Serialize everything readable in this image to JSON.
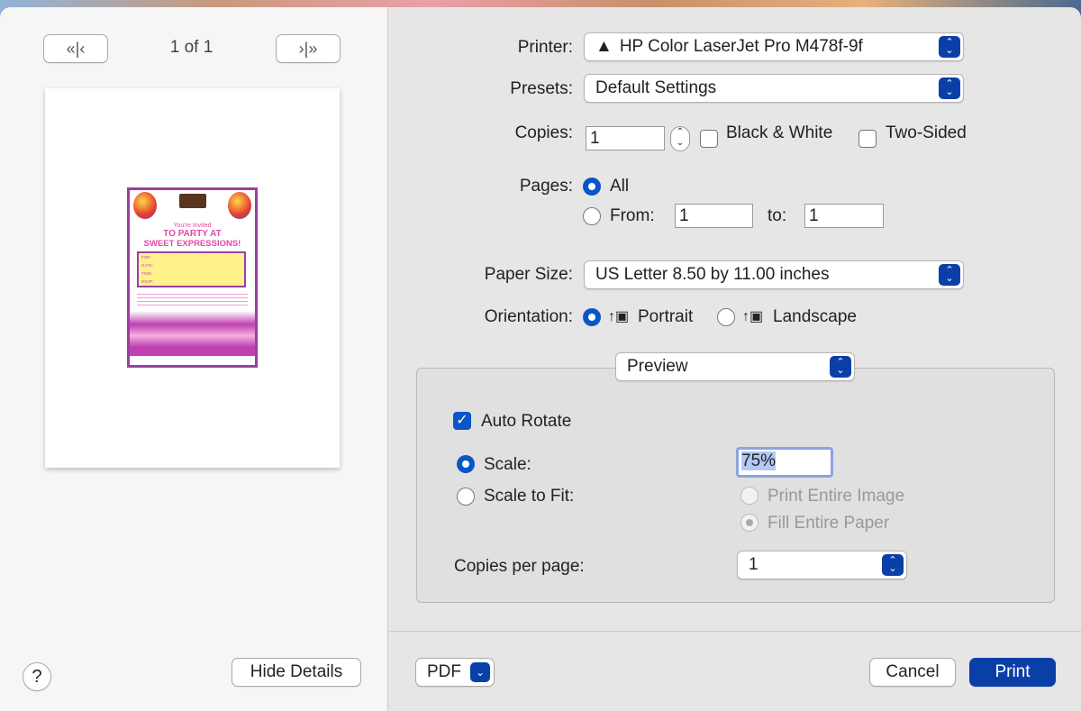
{
  "nav": {
    "first_prev": "«|‹",
    "page_indicator": "1 of 1",
    "next_last": "›|»"
  },
  "flyer": {
    "invited": "You're Invited",
    "line1": "TO PARTY AT",
    "line2": "SWEET EXPRESSIONS!",
    "fields": [
      "FOR:",
      "DATE:",
      "TIME:",
      "RSVP:"
    ]
  },
  "left_bottom": {
    "help": "?",
    "hide_details": "Hide Details"
  },
  "printer": {
    "label": "Printer:",
    "value": "HP Color LaserJet Pro M478f-9f"
  },
  "presets": {
    "label": "Presets:",
    "value": "Default Settings"
  },
  "copies": {
    "label": "Copies:",
    "value": "1",
    "bw": "Black & White",
    "two_sided": "Two-Sided"
  },
  "pages": {
    "label": "Pages:",
    "all": "All",
    "from": "From:",
    "from_value": "1",
    "to": "to:",
    "to_value": "1"
  },
  "paper": {
    "label": "Paper Size:",
    "value": "US Letter 8.50 by 11.00 inches"
  },
  "orientation": {
    "label": "Orientation:",
    "portrait": "Portrait",
    "landscape": "Landscape"
  },
  "section": {
    "value": "Preview"
  },
  "preview": {
    "auto_rotate": "Auto Rotate",
    "scale": "Scale:",
    "scale_value": "75%",
    "scale_to_fit": "Scale to Fit:",
    "print_entire": "Print Entire Image",
    "fill_entire": "Fill Entire Paper",
    "copies_per_page": "Copies per page:",
    "copies_per_page_value": "1"
  },
  "bottom": {
    "pdf": "PDF",
    "cancel": "Cancel",
    "print": "Print"
  },
  "colors": {
    "accent": "#0a3fa8"
  }
}
